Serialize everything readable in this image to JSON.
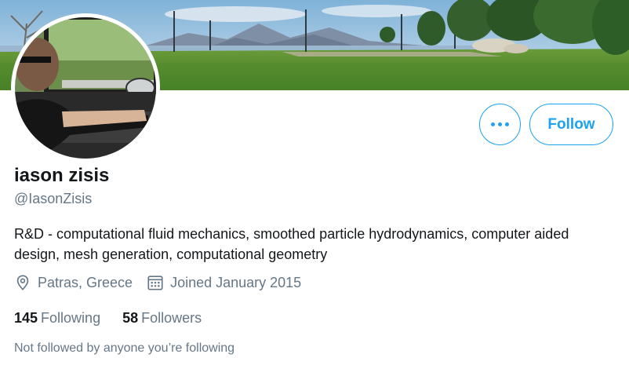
{
  "profile": {
    "display_name": "iason zisis",
    "handle": "@IasonZisis",
    "bio": "R&D - computational fluid mechanics, smoothed particle hydrodynamics, computer aided design, mesh generation, computational geometry",
    "location": "Patras, Greece",
    "joined": "Joined January 2015"
  },
  "actions": {
    "follow_label": "Follow",
    "more_icon": "more-dots-icon"
  },
  "stats": {
    "following_count": "145",
    "following_label": "Following",
    "followers_count": "58",
    "followers_label": "Followers"
  },
  "social_context": "Not followed by anyone you’re following",
  "icons": {
    "location": "location-pin-icon",
    "joined": "calendar-icon"
  },
  "colors": {
    "accent": "#1da1f2",
    "secondary_text": "#657786",
    "primary_text": "#14171a"
  }
}
